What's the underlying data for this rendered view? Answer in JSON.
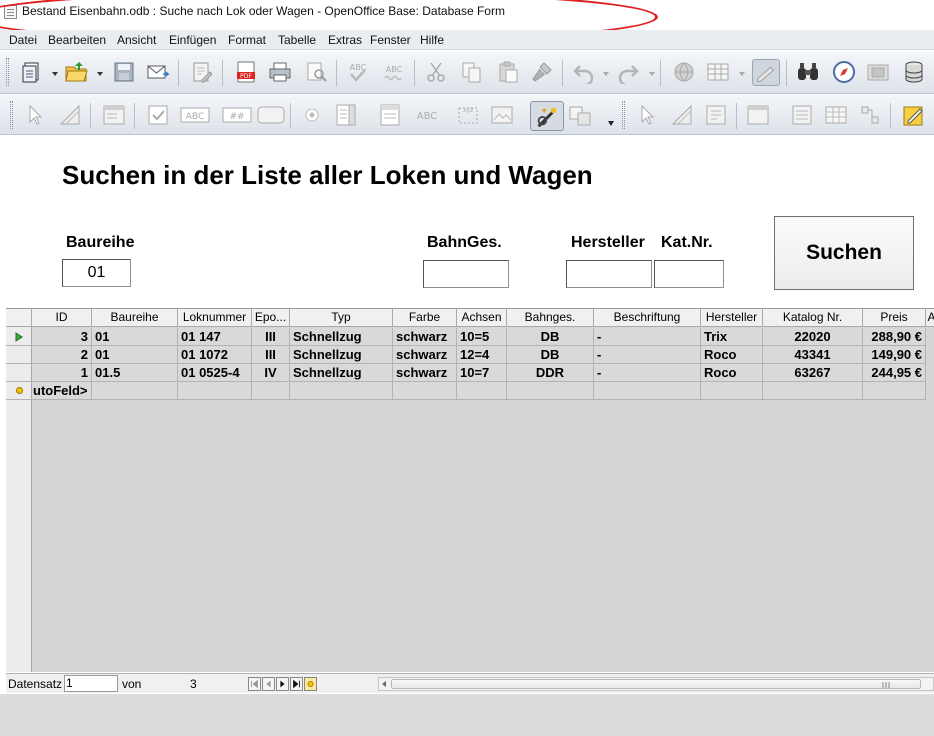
{
  "window": {
    "title": "Bestand Eisenbahn.odb : Suche nach Lok oder Wagen - OpenOffice Base: Database Form"
  },
  "menu": [
    "Datei",
    "Bearbeiten",
    "Ansicht",
    "Einfügen",
    "Format",
    "Tabelle",
    "Extras",
    "Fenster",
    "Hilfe"
  ],
  "toolbar_icons": {
    "row1": [
      "new-document-icon",
      "open-folder-icon",
      "save-icon",
      "email-icon",
      "edit-file-icon",
      "export-pdf-icon",
      "print-icon",
      "print-preview-icon",
      "spellcheck-icon",
      "autospellcheck-icon",
      "cut-icon",
      "copy-icon",
      "paste-icon",
      "format-paintbrush-icon",
      "undo-icon",
      "redo-icon",
      "hyperlink-icon",
      "table-icon",
      "draw-functions-icon",
      "find-binoculars-icon",
      "navigator-compass-icon",
      "gallery-icon",
      "data-sources-icon"
    ],
    "row2": [
      "select-icon",
      "design-mode-icon",
      "control-properties-icon",
      "checkbox-icon",
      "textbox-icon",
      "formatted-field-icon",
      "push-button-icon",
      "option-button-icon",
      "listbox-icon",
      "combobox-icon",
      "label-icon",
      "group-box-icon",
      "image-button-icon",
      "wizards-icon",
      "more-controls-icon",
      "select-icon",
      "design-mode-icon",
      "form-navigator-icon",
      "tab-order-icon",
      "add-field-icon",
      "activation-order-icon",
      "form-design-icon",
      "open-in-design-icon"
    ]
  },
  "form": {
    "title": "Suchen in der Liste aller Loken und Wagen",
    "fields": [
      {
        "label": "Baureihe",
        "value": "01"
      },
      {
        "label": "BahnGes.",
        "value": ""
      },
      {
        "label": "Hersteller",
        "value": ""
      },
      {
        "label": "Kat.Nr.",
        "value": ""
      }
    ],
    "search_button": "Suchen"
  },
  "grid": {
    "columns": [
      "ID",
      "Baureihe",
      "Loknummer",
      "Epo...",
      "Typ",
      "Farbe",
      "Achsen",
      "Bahnges.",
      "Beschriftung",
      "Hersteller",
      "Katalog Nr.",
      "Preis",
      "A"
    ],
    "rows": [
      [
        "3",
        "01",
        "01 147",
        "III",
        "Schnellzug",
        "schwarz",
        "10=5",
        "DB",
        "-",
        "Trix",
        "22020",
        "288,90 €"
      ],
      [
        "2",
        "01",
        "01 1072",
        "III",
        "Schnellzug",
        "schwarz",
        "12=4",
        "DB",
        "-",
        "Roco",
        "43341",
        "149,90 €"
      ],
      [
        "1",
        "01.5",
        "01 0525-4",
        "IV",
        "Schnellzug",
        "schwarz",
        "10=7",
        "DDR",
        "-",
        "Roco",
        "63267",
        "244,95 €"
      ]
    ],
    "new_row_text": "utoFeld>"
  },
  "navigation": {
    "label": "Datensatz",
    "current": "1",
    "of_label": "von",
    "total": "3"
  }
}
